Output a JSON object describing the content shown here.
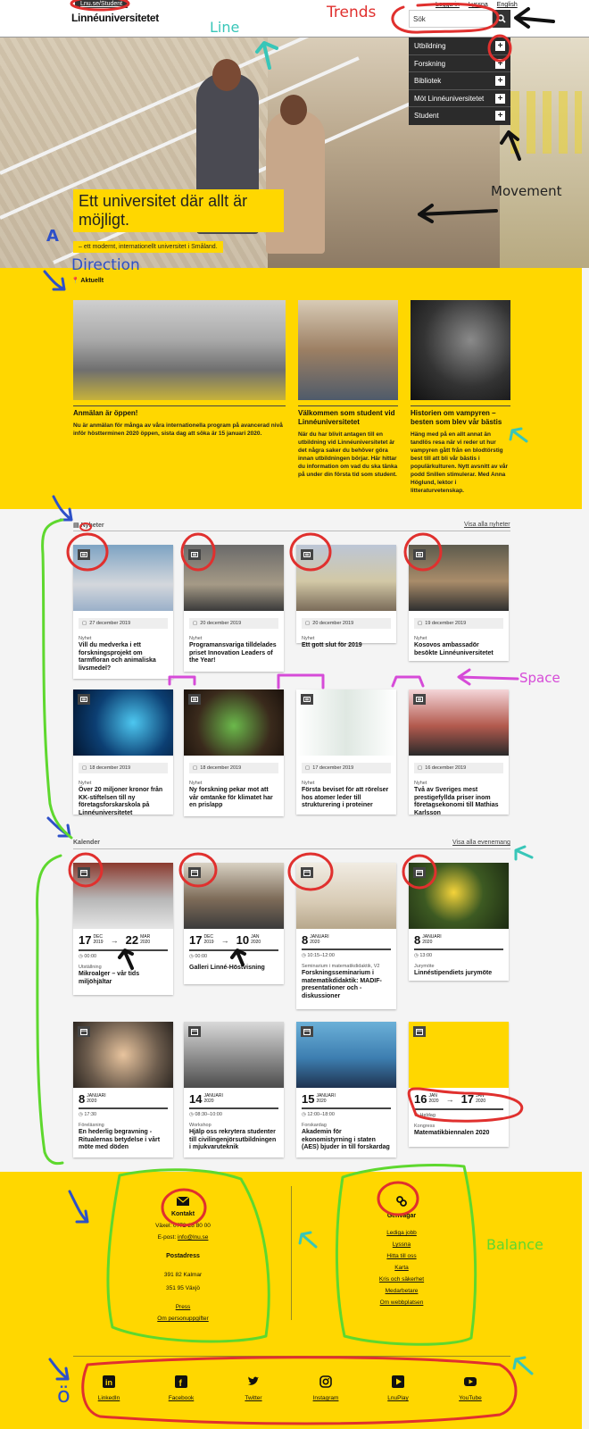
{
  "header": {
    "top_tab": "Lnu.se/Student",
    "logo": "Linnéuniversitetet",
    "top_links": [
      "Logga in",
      "Lyssna",
      "English"
    ],
    "search_placeholder": "Sök"
  },
  "menu": [
    "Utbildning",
    "Forskning",
    "Bibliotek",
    "Möt Linnéuniversitetet",
    "Student"
  ],
  "hero": {
    "title": "Ett universitet där allt är möjligt.",
    "subtitle": "– ett modernt, internationellt universitet i Småland."
  },
  "annotations": {
    "trends": "Trends",
    "line": "Line",
    "movement": "Movement",
    "direction": "Direction",
    "space": "Space",
    "balance": "Balance",
    "a_mark": "A",
    "o_mark": "ö",
    "colors": {
      "red": "#e0302e",
      "teal": "#38c6b8",
      "blue": "#2d50c8",
      "magenta": "#d64bd8",
      "green": "#5ed82e",
      "black": "#111111"
    }
  },
  "aktuellt": {
    "label": "Aktuellt",
    "items": [
      {
        "title": "Anmälan är öppen!",
        "text": "Nu är anmälan för många av våra internationella program på avancerad nivå inför höstterminen 2020 öppen, sista dag att söka är 15 januari 2020."
      },
      {
        "title": "Välkommen som student vid Linnéuniversitetet",
        "text": "När du har blivit antagen till en utbildning vid Linnéuniversitetet är det några saker du behöver göra innan utbildningen börjar. Här hittar du information om vad du ska tänka på under din första tid som student."
      },
      {
        "title": "Historien om vampyren – besten som blev vår bästis",
        "text": "Häng med på en allt annat än tandlös resa när vi reder ut hur vampyren gått från en blodtörstig best till att bli vår bästis i populärkulturen. Nytt avsnitt av vår podd Snillen stimulerar. Med Anna Höglund, lektor i litteraturvetenskap."
      }
    ]
  },
  "nyheter": {
    "label": "Nyheter",
    "link": "Visa alla nyheter",
    "items": [
      {
        "date": "27 december 2019",
        "type": "Nyhet",
        "title": "Vill du medverka i ett forskningsprojekt om tarmfloran och animaliska livsmedel?"
      },
      {
        "date": "20 december 2019",
        "type": "Nyhet",
        "title": "Programansvariga tilldelades priset Innovation Leaders of the Year!"
      },
      {
        "date": "20 december 2019",
        "type": "Nyhet",
        "title": "Ett gott slut för 2019"
      },
      {
        "date": "19 december 2019",
        "type": "Nyhet",
        "title": "Kosovos ambassadör besökte Linnéuniversitetet"
      },
      {
        "date": "18 december 2019",
        "type": "Nyhet",
        "title": "Över 20 miljoner kronor från KK-stiftelsen till ny företagsforskarskola på Linnéuniversitetet"
      },
      {
        "date": "18 december 2019",
        "type": "Nyhet",
        "title": "Ny forskning pekar mot att vår omtanke för klimatet har en prislapp"
      },
      {
        "date": "17 december 2019",
        "type": "Nyhet",
        "title": "Första beviset för att rörelser hos atomer leder till strukturering i proteiner"
      },
      {
        "date": "16 december 2019",
        "type": "Nyhet",
        "title": "Två av Sveriges mest prestigefyllda priser inom företagsekonomi till Mathias Karlsson"
      }
    ]
  },
  "kalender": {
    "label": "Kalender",
    "link": "Visa alla evenemang",
    "items": [
      {
        "d1": "17",
        "m1": "DEC",
        "y1": "2019",
        "d2": "22",
        "m2": "MAR",
        "y2": "2020",
        "time": "00:00",
        "type": "Utställning",
        "title": "Mikroalger – vår tids miljöhjältar"
      },
      {
        "d1": "17",
        "m1": "DEC",
        "y1": "2019",
        "d2": "10",
        "m2": "JAN",
        "y2": "2020",
        "time": "00:00",
        "type": "",
        "title": "Galleri Linné-Höstvisning"
      },
      {
        "d1": "8",
        "m1": "JANUARI",
        "y1": "2020",
        "d2": "",
        "m2": "",
        "y2": "",
        "time": "10:15–12:00",
        "type": "Seminarium i matematikdidaktik, V2",
        "title": "Forskningsseminarium i matematikdidaktik: MADIF-presentationer och -diskussioner"
      },
      {
        "d1": "8",
        "m1": "JANUARI",
        "y1": "2020",
        "d2": "",
        "m2": "",
        "y2": "",
        "time": "13:00",
        "type": "Jurymöte",
        "title": "Linnéstipendiets jurymöte"
      },
      {
        "d1": "8",
        "m1": "JANUARI",
        "y1": "2020",
        "d2": "",
        "m2": "",
        "y2": "",
        "time": "17:30",
        "type": "Föreläsning",
        "title": "En hederlig begravning - Ritualernas betydelse i vårt möte med döden"
      },
      {
        "d1": "14",
        "m1": "JANUARI",
        "y1": "2020",
        "d2": "",
        "m2": "",
        "y2": "",
        "time": "08:30–10:00",
        "type": "Workshop",
        "title": "Hjälp oss rekrytera studenter till civilingenjörsutbildningen i mjukvaruteknik"
      },
      {
        "d1": "15",
        "m1": "JANUARI",
        "y1": "2020",
        "d2": "",
        "m2": "",
        "y2": "",
        "time": "12:00–18:00",
        "type": "Forskardag",
        "title": "Akademin för ekonomistyrning i staten (AES) bjuder in till forskardag"
      },
      {
        "d1": "16",
        "m1": "JAN",
        "y1": "2020",
        "d2": "17",
        "m2": "JAN",
        "y2": "2020",
        "time": "Heldag",
        "type": "Kongress",
        "title": "Matematikbiennalen 2020"
      }
    ]
  },
  "footer": {
    "kontakt": {
      "title": "Kontakt",
      "phone": "Växel: 0772-28 80 00",
      "email_label": "E-post:",
      "email": "info@lnu.se",
      "postadress_title": "Postadress",
      "addr1": "391 82 Kalmar",
      "addr2": "351 95 Växjö",
      "press": "Press",
      "personuppgifter": "Om personuppgifter"
    },
    "genvagar": {
      "title": "Genvägar",
      "links": [
        "Lediga jobb",
        "Lyssna",
        "Hitta till oss",
        "Karta",
        "Kris och säkerhet",
        "Medarbetare",
        "Om webbplatsen"
      ]
    },
    "social": [
      "LinkedIn",
      "Facebook",
      "Twitter",
      "Instagram",
      "LnuPlay",
      "YouTube"
    ]
  }
}
